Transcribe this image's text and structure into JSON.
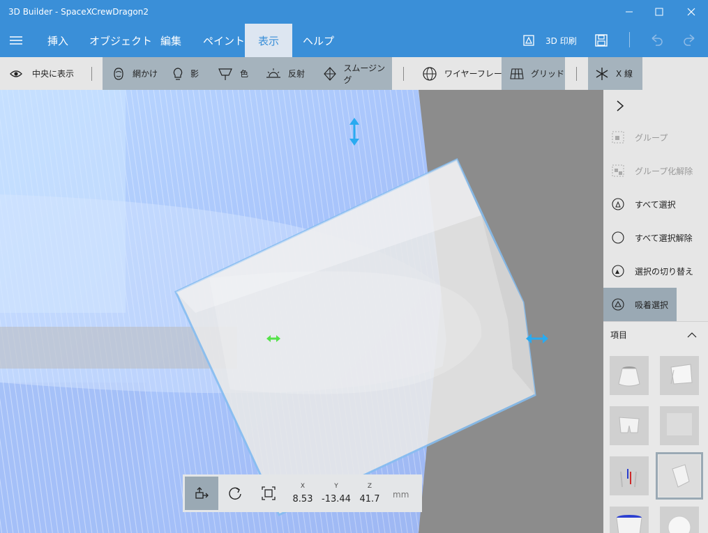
{
  "window": {
    "title": "3D Builder - SpaceXCrewDragon2"
  },
  "menu": {
    "tabs": [
      {
        "label": "挿入"
      },
      {
        "label": "オブジェクト"
      },
      {
        "label": "編集"
      },
      {
        "label": "ペイント"
      },
      {
        "label": "表示"
      },
      {
        "label": "ヘルプ"
      }
    ],
    "active_tab": "表示",
    "print_label": "3D 印刷"
  },
  "toolbar": {
    "center_view": "中央に表示",
    "mesh": "網かけ",
    "shadow": "影",
    "color": "色",
    "reflection": "反射",
    "smoothing": "スムージング",
    "wireframe": "ワイヤーフレーム",
    "grid": "グリッド",
    "xray": "X 線"
  },
  "sidepanel": {
    "items": [
      {
        "label": "グループ",
        "icon": "group-icon",
        "enabled": false
      },
      {
        "label": "グループ化解除",
        "icon": "ungroup-icon",
        "enabled": false
      },
      {
        "label": "すべて選択",
        "icon": "select-all-icon",
        "enabled": true
      },
      {
        "label": "すべて選択解除",
        "icon": "deselect-all-icon",
        "enabled": true
      },
      {
        "label": "選択の切り替え",
        "icon": "toggle-selection-icon",
        "enabled": true
      },
      {
        "label": "吸着選択",
        "icon": "magnet-select-icon",
        "enabled": true,
        "active": true
      }
    ],
    "items_header": "項目"
  },
  "status": {
    "x_label": "X",
    "x_value": "8.53",
    "y_label": "Y",
    "y_value": "-13.44",
    "z_label": "Z",
    "z_value": "41.7",
    "unit": "mm"
  },
  "colors": {
    "accent": "#3a8fd8",
    "toolbar_active": "#9aa9b4",
    "arrow": "#29aaf0",
    "arrow_green": "#55e24a"
  }
}
